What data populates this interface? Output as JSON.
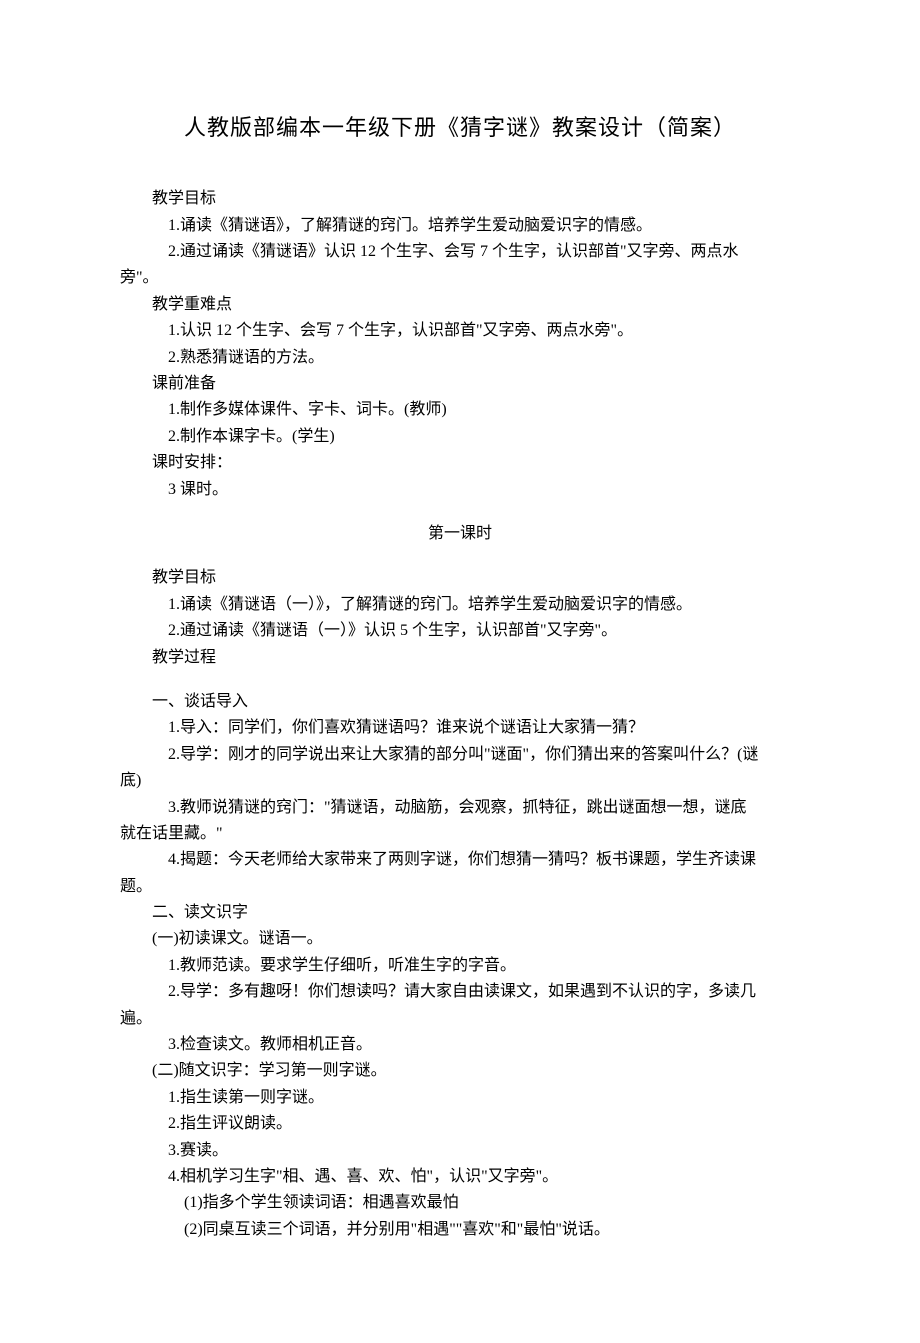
{
  "title": "人教版部编本一年级下册《猜字谜》教案设计（简案）",
  "goals_label": "教学目标",
  "goals": [
    "1.诵读《猜谜语》，了解猜谜的窍门。培养学生爱动脑爱识字的情感。",
    "2.通过诵读《猜谜语》认识 12 个生字、会写 7 个生字，认识部首\"又字旁、两点水"
  ],
  "goals_cont": "旁\"。",
  "difficulty_label": "教学重难点",
  "difficulty": [
    "1.认识 12 个生字、会写 7 个生字，认识部首\"又字旁、两点水旁\"。",
    "2.熟悉猜谜语的方法。"
  ],
  "prep_label": "课前准备",
  "prep": [
    "1.制作多媒体课件、字卡、词卡。(教师)",
    "2.制作本课字卡。(学生)"
  ],
  "schedule_label": "课时安排：",
  "schedule_value": "3 课时。",
  "lesson1_label": "第一课时",
  "l1_goals_label": "教学目标",
  "l1_goals": [
    "1.诵读《猜谜语（一）》，了解猜谜的窍门。培养学生爱动脑爱识字的情感。",
    "2.通过诵读《猜谜语（一）》认识 5 个生字，认识部首\"又字旁\"。"
  ],
  "process_label": "教学过程",
  "sec1_label": "一、谈话导入",
  "sec1_items": {
    "i1": "1.导入：同学们，你们喜欢猜谜语吗？谁来说个谜语让大家猜一猜？",
    "i2": "2.导学：刚才的同学说出来让大家猜的部分叫\"谜面\"，你们猜出来的答案叫什么？(谜",
    "i2_cont": "底)",
    "i3": "3.教师说猜谜的窍门：\"猜谜语，动脑筋，会观察，抓特征，跳出谜面想一想，谜底",
    "i3_cont": "就在话里藏。\"",
    "i4": "4.揭题：今天老师给大家带来了两则字谜，你们想猜一猜吗？板书课题，学生齐读课",
    "i4_cont": "题。"
  },
  "sec2_label": "二、读文识字",
  "sec2_sub1_label": "(一)初读课文。谜语一。",
  "sec2_sub1_items": {
    "i1": "1.教师范读。要求学生仔细听，听准生字的字音。",
    "i2": "2.导学：多有趣呀！你们想读吗？请大家自由读课文，如果遇到不认识的字，多读几",
    "i2_cont": "遍。",
    "i3": "3.检查读文。教师相机正音。"
  },
  "sec2_sub2_label": "(二)随文识字：学习第一则字谜。",
  "sec2_sub2_items": [
    "1.指生读第一则字谜。",
    "2.指生评议朗读。",
    "3.赛读。",
    "4.相机学习生字\"相、遇、喜、欢、怕\"，认识\"又字旁\"。"
  ],
  "sec2_sub2_sub": [
    "(1)指多个学生领读词语：相遇喜欢最怕",
    "(2)同桌互读三个词语，并分别用\"相遇\"\"喜欢\"和\"最怕\"说话。"
  ]
}
